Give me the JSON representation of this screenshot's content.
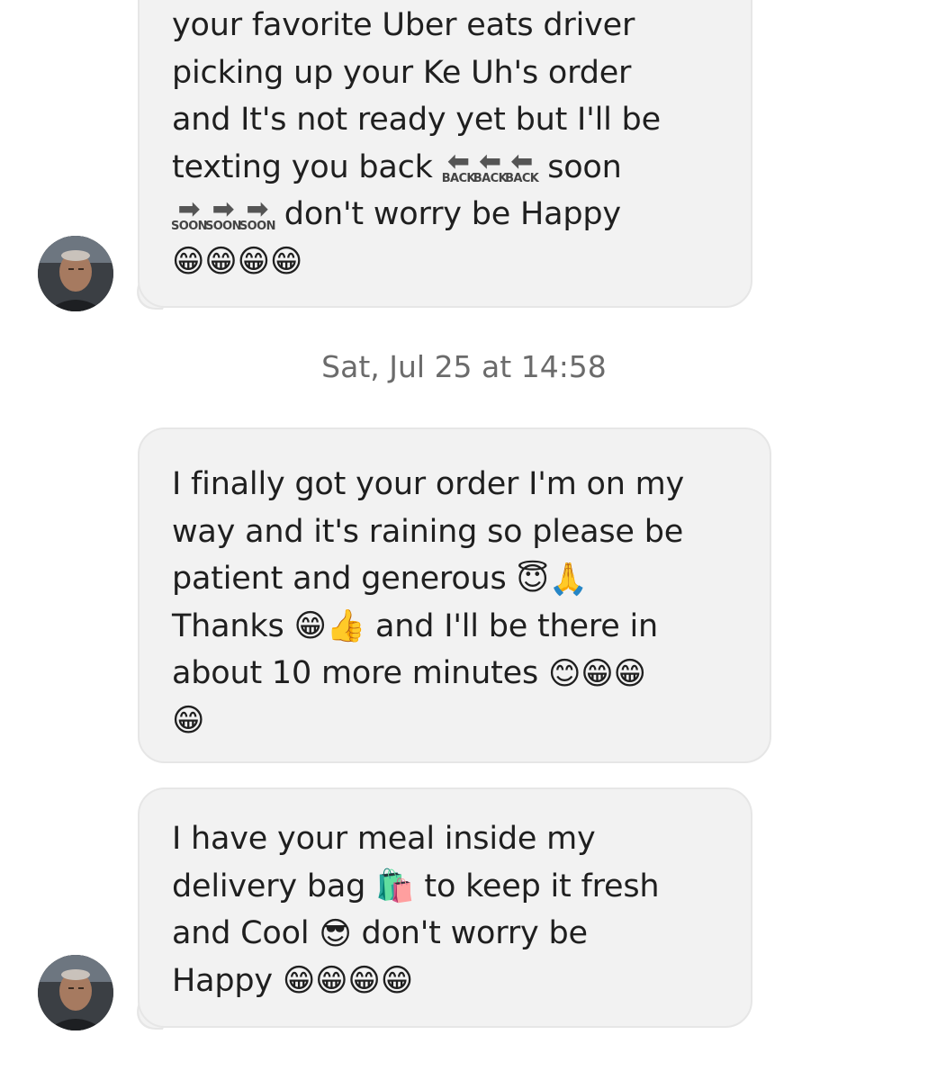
{
  "messages": [
    {
      "lines": [
        "your favorite Uber eats driver",
        "picking up your Ke Uh's order",
        "and It's not ready yet but I'll be",
        "texting you back",
        "soon",
        "don't worry be Happy"
      ],
      "signs": {
        "back": {
          "arrow": "⬅",
          "label": "BACK"
        },
        "soon": {
          "arrow": "➡",
          "label": "SOON"
        }
      },
      "emoji_line": "😁😁😁😁"
    },
    {
      "lines": [
        "I finally got your order I'm on my",
        "way and it's raining so please be",
        "patient and generous",
        "Thanks",
        "and I'll be there in",
        "about 10 more minutes"
      ],
      "emojis": {
        "halo_pray": "😇🙏",
        "grin_thumb": "😁👍",
        "end": "😊😁😁",
        "last": "😁"
      }
    },
    {
      "lines": [
        "I have your meal inside my",
        "delivery bag",
        "to keep it fresh",
        "and Cool",
        "don't worry be",
        "Happy"
      ],
      "emojis": {
        "bag": "🛍️",
        "sunglasses": "😎",
        "grins": "😁😁😁😁"
      }
    }
  ],
  "timestamp": "Sat, Jul 25 at 14:58",
  "colors": {
    "bubble_bg": "#f2f2f2",
    "bubble_border": "#e6e6e6",
    "timestamp": "#6b6b6b"
  }
}
